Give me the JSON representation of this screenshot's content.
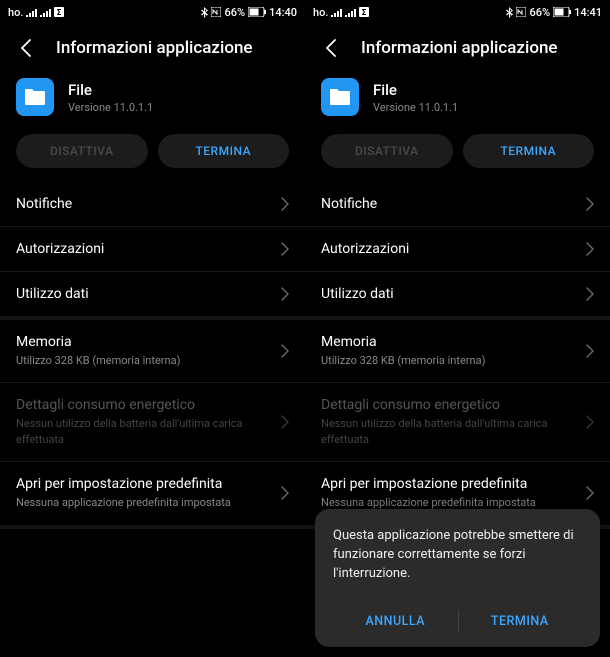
{
  "screens": [
    {
      "status": {
        "carrier": "ho.",
        "battery": "66%",
        "time": "14:40"
      },
      "dialog": null
    },
    {
      "status": {
        "carrier": "ho.",
        "battery": "66%",
        "time": "14:41"
      },
      "dialog": {
        "text": "Questa applicazione potrebbe smettere di funzionare correttamente se forzi l'interruzione.",
        "cancel": "ANNULLA",
        "confirm": "TERMINA"
      }
    }
  ],
  "title": "Informazioni applicazione",
  "app": {
    "name": "File",
    "version": "Versione 11.0.1.1"
  },
  "buttons": {
    "disable": "DISATTIVA",
    "terminate": "TERMINA"
  },
  "items": {
    "notifications": "Notifiche",
    "permissions": "Autorizzazioni",
    "data_usage": "Utilizzo dati",
    "storage_title": "Memoria",
    "storage_sub": "Utilizzo 328 KB (memoria interna)",
    "energy_title": "Dettagli consumo energetico",
    "energy_sub": "Nessun utilizzo della batteria dall'ultima carica effettuata",
    "default_title": "Apri per impostazione predefinita",
    "default_sub": "Nessuna applicazione predefinita impostata"
  }
}
